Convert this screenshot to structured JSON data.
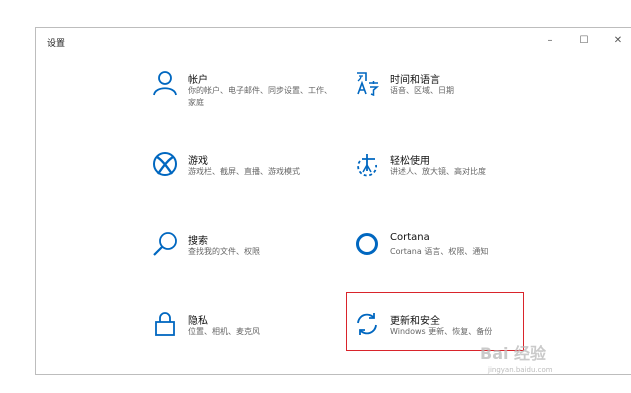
{
  "window": {
    "title": "设置",
    "min_glyph": "–",
    "max_glyph": "☐",
    "close_glyph": "✕"
  },
  "tiles": [
    {
      "name": "帐户",
      "desc": "你的帐户、电子邮件、同步设置、工作、家庭",
      "icon": "person-icon"
    },
    {
      "name": "时间和语言",
      "desc": "语音、区域、日期",
      "icon": "language-icon"
    },
    {
      "name": "游戏",
      "desc": "游戏栏、截屏、直播、游戏模式",
      "icon": "xbox-icon"
    },
    {
      "name": "轻松使用",
      "desc": "讲述人、放大镜、高对比度",
      "icon": "ease-of-access-icon"
    },
    {
      "name": "搜索",
      "desc": "查找我的文件、权限",
      "icon": "search-icon"
    },
    {
      "name": "Cortana",
      "desc": "Cortana 语言、权限、通知",
      "icon": "cortana-icon"
    },
    {
      "name": "隐私",
      "desc": "位置、相机、麦克风",
      "icon": "lock-icon"
    },
    {
      "name": "更新和安全",
      "desc": "Windows 更新、恢复、备份",
      "icon": "sync-icon"
    }
  ],
  "colors": {
    "accent": "#0067c0",
    "highlight": "#d9242b"
  },
  "watermark": {
    "brand": "Bai 经验",
    "url": "jingyan.baidu.com"
  }
}
